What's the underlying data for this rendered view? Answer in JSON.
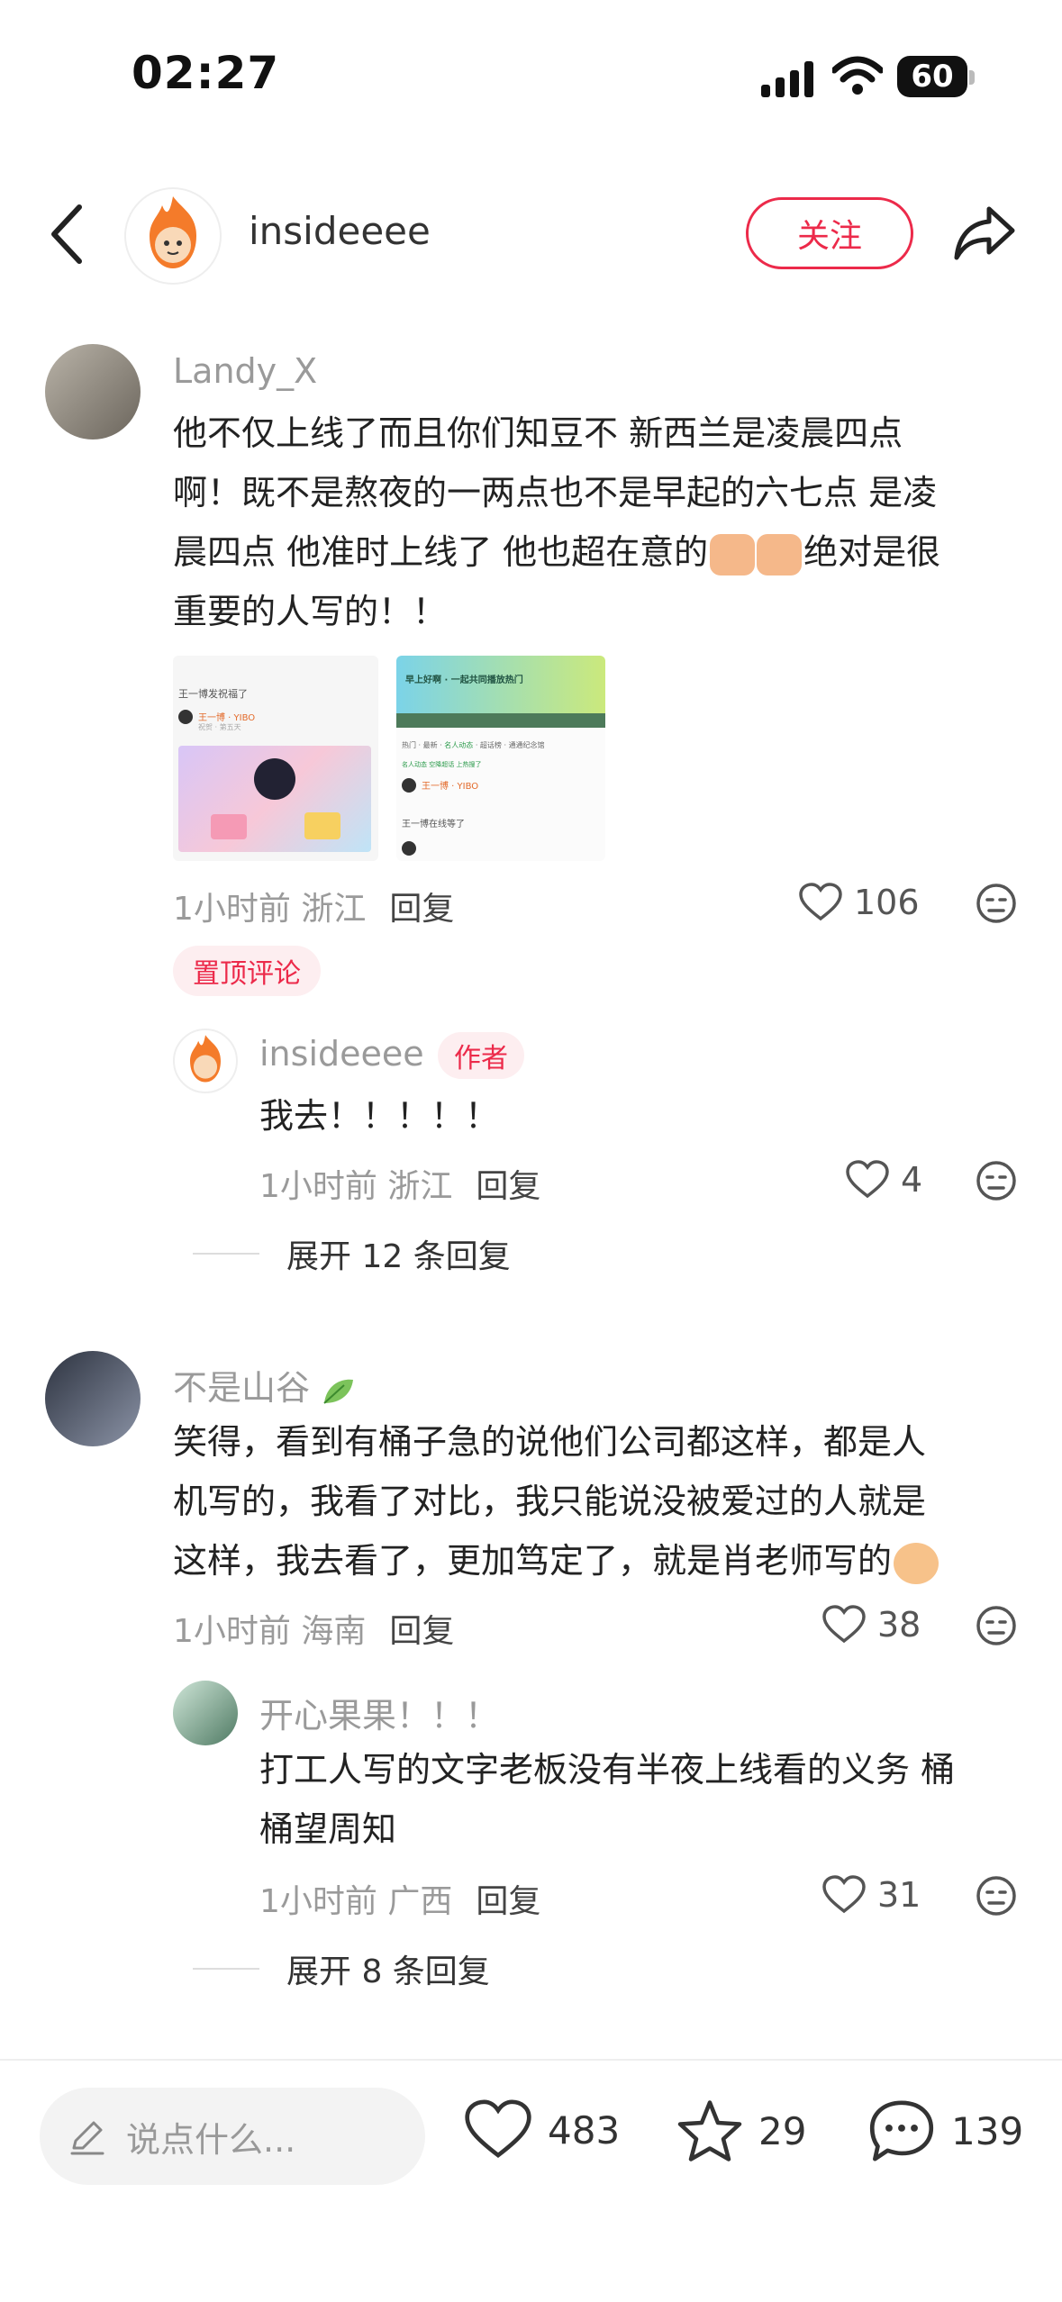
{
  "status_bar": {
    "time": "02:27",
    "battery": "60"
  },
  "header": {
    "username": "insideeee",
    "follow_label": "关注"
  },
  "comments": [
    {
      "username": "Landy_X",
      "lines": [
        "他不仅上线了而且你们知豆不 新西兰是凌晨四点",
        "啊！既不是熬夜的一两点也不是早起的六七点 是凌",
        "晨四点 他准时上线了 他也超在意的",
        "重要的人写的！！"
      ],
      "line3_tail": "绝对是很",
      "images": [
        {
          "caption_top": "王一博发祝福了",
          "user_label": "王一博 · YIBO",
          "sub": "祝贺 · 第五天"
        },
        {
          "banner": "早上好啊 · 一起共同播放热门",
          "tabs": [
            "热门",
            "最新",
            "名人动态",
            "超话榜",
            "通通纪念馆",
            "音乐"
          ],
          "chips": [
            "名人动态",
            "空降超话",
            "上热搜了"
          ],
          "user_label": "王一博 · YIBO",
          "caption_bottom": "王一博在线等了"
        }
      ],
      "time": "1小时前",
      "location": "浙江",
      "reply_label": "回复",
      "likes": "106",
      "pinned_label": "置顶评论",
      "replies": [
        {
          "username": "insideeee",
          "author_tag": "作者",
          "text": "我去！！！！！",
          "time": "1小时前",
          "location": "浙江",
          "reply_label": "回复",
          "likes": "4"
        }
      ],
      "expand_label": "展开 12 条回复"
    },
    {
      "username": "不是山谷",
      "lines": [
        "笑得，看到有桶子急的说他们公司都这样，都是人",
        "机写的，我看了对比，我只能说没被爱过的人就是",
        "这样，我去看了，更加笃定了，就是肖老师写的"
      ],
      "time": "1小时前",
      "location": "海南",
      "reply_label": "回复",
      "likes": "38",
      "replies": [
        {
          "username": "开心果果！！！",
          "lines": [
            "打工人写的文字老板没有半夜上线看的义务 桶",
            "桶望周知"
          ],
          "time": "1小时前",
          "location": "广西",
          "reply_label": "回复",
          "likes": "31"
        }
      ],
      "expand_label": "展开 8 条回复"
    }
  ],
  "bottom_bar": {
    "input_placeholder": "说点什么...",
    "likes": "483",
    "favorites": "29",
    "comments": "139"
  },
  "colors": {
    "accent": "#ec2a4a",
    "muted": "#9a9a9a"
  }
}
